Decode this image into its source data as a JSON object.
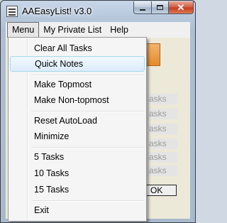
{
  "window": {
    "title": "AAEasyList! v3.0"
  },
  "menubar": {
    "items": [
      "Menu",
      "My Private List",
      "Help"
    ]
  },
  "menu": {
    "items": [
      {
        "label": "Clear All Tasks"
      },
      {
        "label": "Quick Notes"
      },
      {
        "label": "Make Topmost"
      },
      {
        "label": "Make Non-topmost"
      },
      {
        "label": "Reset AutoLoad"
      },
      {
        "label": "Minimize"
      },
      {
        "label": "5 Tasks"
      },
      {
        "label": "10 Tasks"
      },
      {
        "label": "15 Tasks"
      },
      {
        "label": "Exit"
      }
    ]
  },
  "background": {
    "task_labels": [
      "asks",
      "asks",
      "asks",
      "asks",
      "asks",
      "asks",
      "asks",
      "asks"
    ],
    "ok_label": "OK"
  },
  "icons": {
    "app": "list-icon",
    "minimize": "minimize-icon",
    "maximize": "maximize-icon",
    "close": "close-icon"
  },
  "colors": {
    "close_button": "#c23a1f",
    "menu_hover": "#dcecfc",
    "tile": "#e58a2a"
  }
}
